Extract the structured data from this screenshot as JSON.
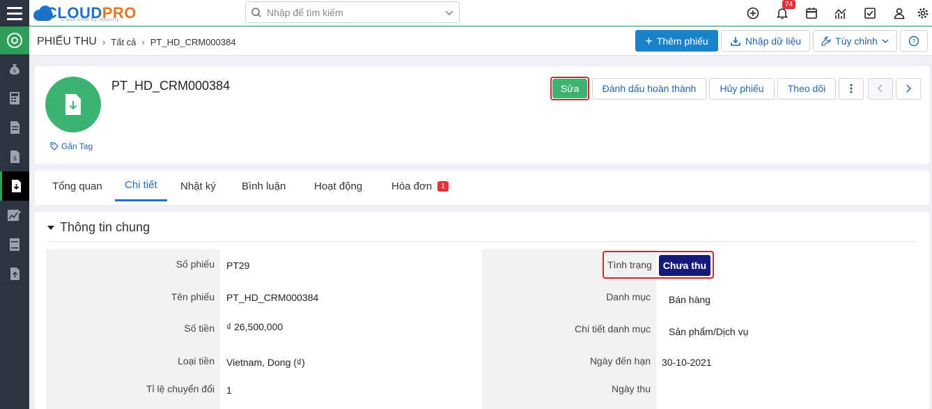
{
  "app": {
    "logo_text_a": "CLOUD",
    "logo_text_b": "PRO",
    "logo_tagline": "Cloud CRM By Industry",
    "search_placeholder": "Nhập để tìm kiếm",
    "notification_count": "74"
  },
  "breadcrumb": {
    "module": "PHIẾU THU",
    "level1": "Tất cả",
    "level2": "PT_HD_CRM000384"
  },
  "toolbar": {
    "add_label": "Thêm phiếu",
    "import_label": "Nhập dữ liệu",
    "customize_label": "Tùy chỉnh"
  },
  "record": {
    "title": "PT_HD_CRM000384",
    "tag_label": "Gắn Tag",
    "actions": {
      "edit": "Sửa",
      "mark_done": "Đánh dấu hoàn thành",
      "cancel": "Hủy phiếu",
      "follow": "Theo dõi"
    }
  },
  "tabs": [
    {
      "label": "Tổng quan"
    },
    {
      "label": "Chi tiết"
    },
    {
      "label": "Nhật ký"
    },
    {
      "label": "Bình luận"
    },
    {
      "label": "Hoạt động"
    },
    {
      "label": "Hóa đơn",
      "badge": "1"
    }
  ],
  "section": {
    "title": "Thông tin chung",
    "left_fields": [
      {
        "label": "Số phiếu",
        "value": "PT29"
      },
      {
        "label": "Tên phiếu",
        "value": "PT_HD_CRM000384"
      },
      {
        "label": "Số tiền",
        "value": "₫ 26,500,000"
      },
      {
        "label": "Loại tiền",
        "value": "Vietnam, Dong (₫)"
      },
      {
        "label": "Tỉ lệ chuyển đổi",
        "value": "1"
      }
    ],
    "right_fields": [
      {
        "label": "Tình trạng",
        "value": "Chưa thu"
      },
      {
        "label": "Danh mục",
        "value": "Bán hàng"
      },
      {
        "label": "Chi tiết danh mục",
        "value": "Sản phẩm/Dịch vụ"
      },
      {
        "label": "Ngày đến hạn",
        "value": "30-10-2021"
      },
      {
        "label": "Ngày thu",
        "value": ""
      }
    ]
  },
  "colors": {
    "primary": "#1a82c9",
    "success": "#3cb371",
    "sidebar": "#2c3440",
    "status_badge": "#141a7a",
    "highlight": "#d9232d"
  }
}
